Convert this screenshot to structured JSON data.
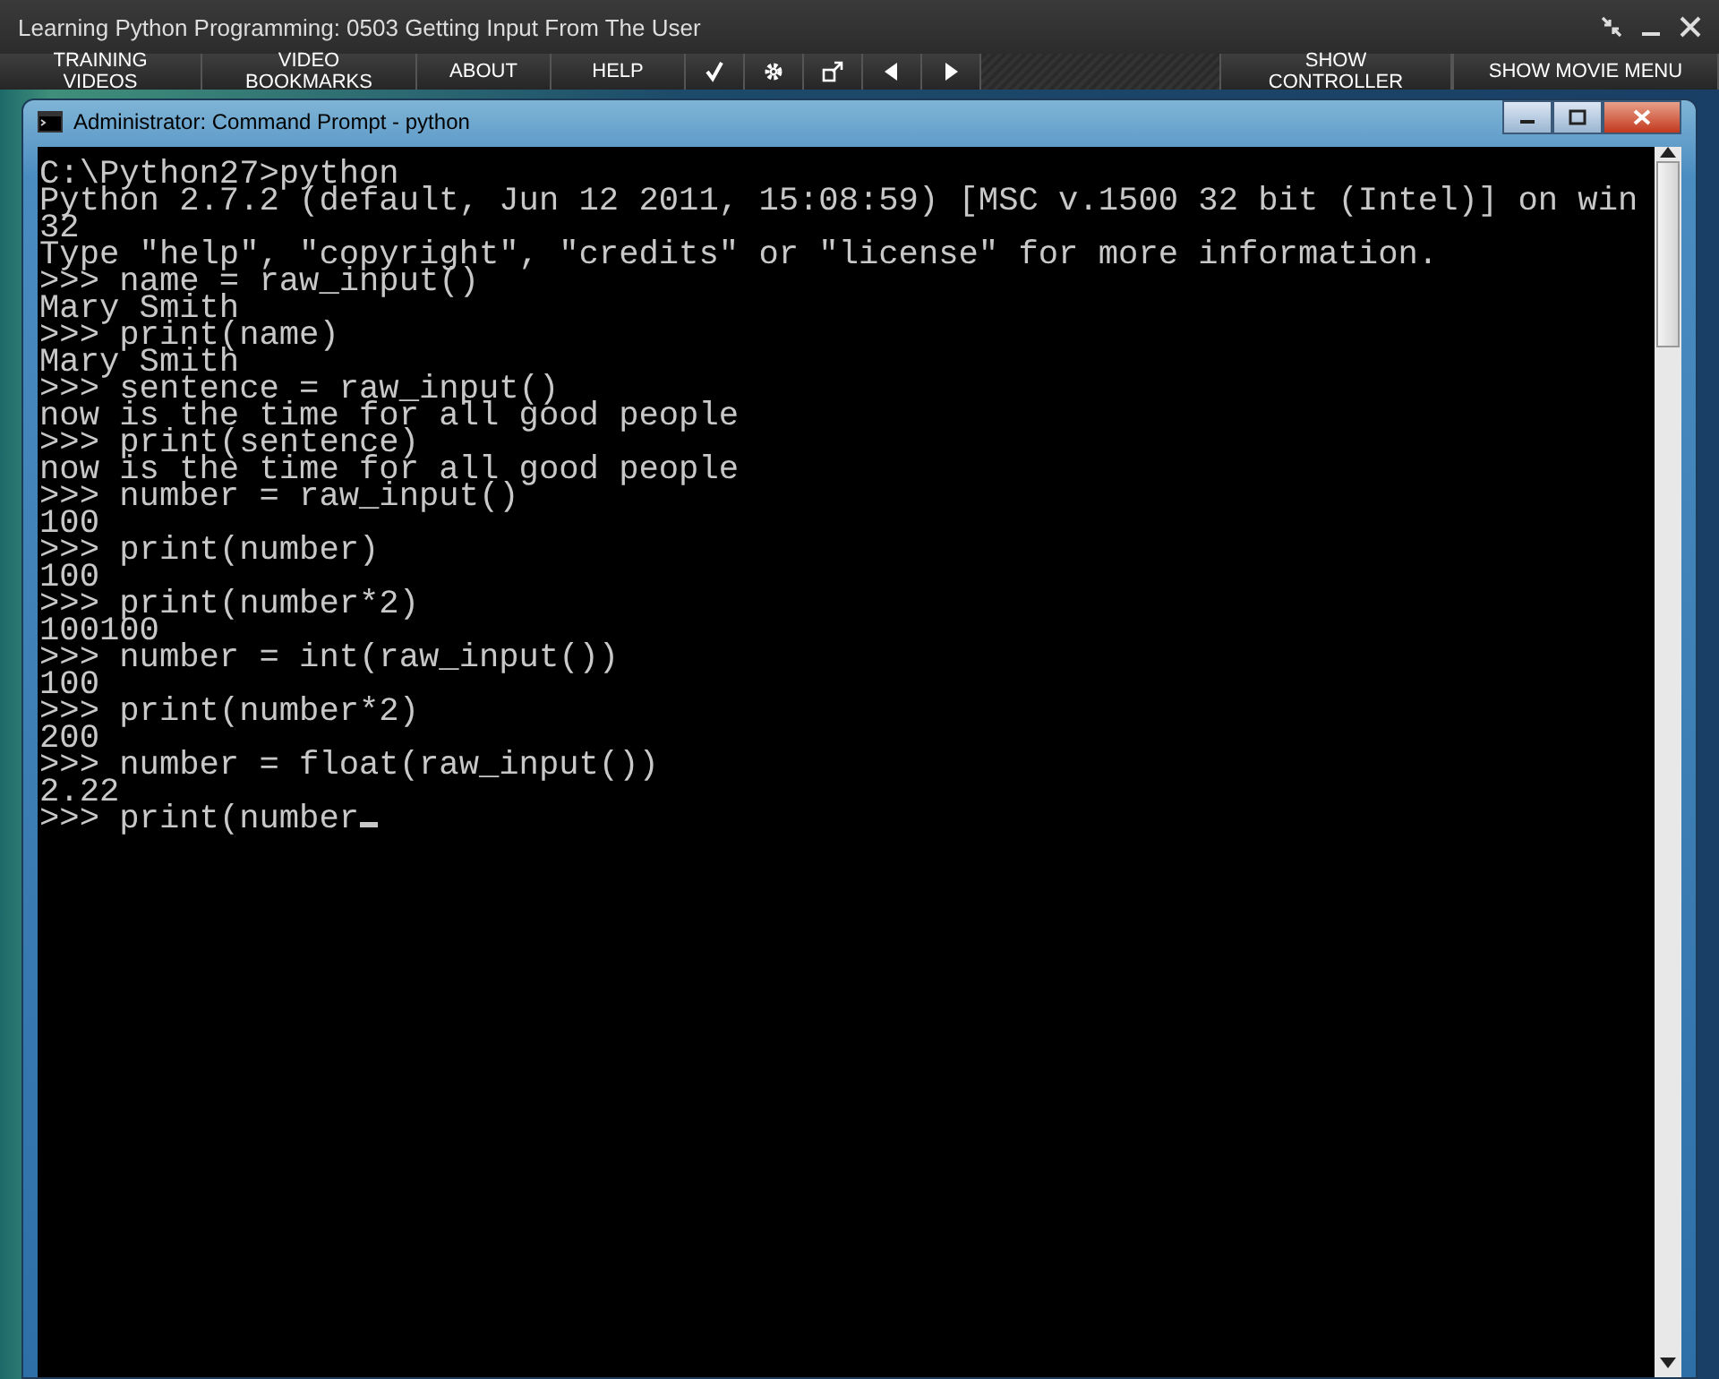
{
  "app": {
    "title": "Learning Python Programming: 0503 Getting Input From The User"
  },
  "toolbar": {
    "left_buttons": [
      "TRAINING VIDEOS",
      "VIDEO BOOKMARKS",
      "ABOUT",
      "HELP"
    ],
    "right_buttons": [
      "SHOW CONTROLLER",
      "SHOW MOVIE MENU"
    ]
  },
  "window": {
    "title": "Administrator: Command Prompt - python"
  },
  "console": {
    "lines": [
      "C:\\Python27>python",
      "Python 2.7.2 (default, Jun 12 2011, 15:08:59) [MSC v.1500 32 bit (Intel)] on win",
      "32",
      "Type \"help\", \"copyright\", \"credits\" or \"license\" for more information.",
      ">>> name = raw_input()",
      "Mary Smith",
      ">>> print(name)",
      "Mary Smith",
      ">>> sentence = raw_input()",
      "now is the time for all good people",
      ">>> print(sentence)",
      "now is the time for all good people",
      ">>> number = raw_input()",
      "100",
      ">>> print(number)",
      "100",
      ">>> print(number*2)",
      "100100",
      ">>> number = int(raw_input())",
      "100",
      ">>> print(number*2)",
      "200",
      ">>> number = float(raw_input())",
      "2.22",
      ">>> print(number"
    ]
  }
}
